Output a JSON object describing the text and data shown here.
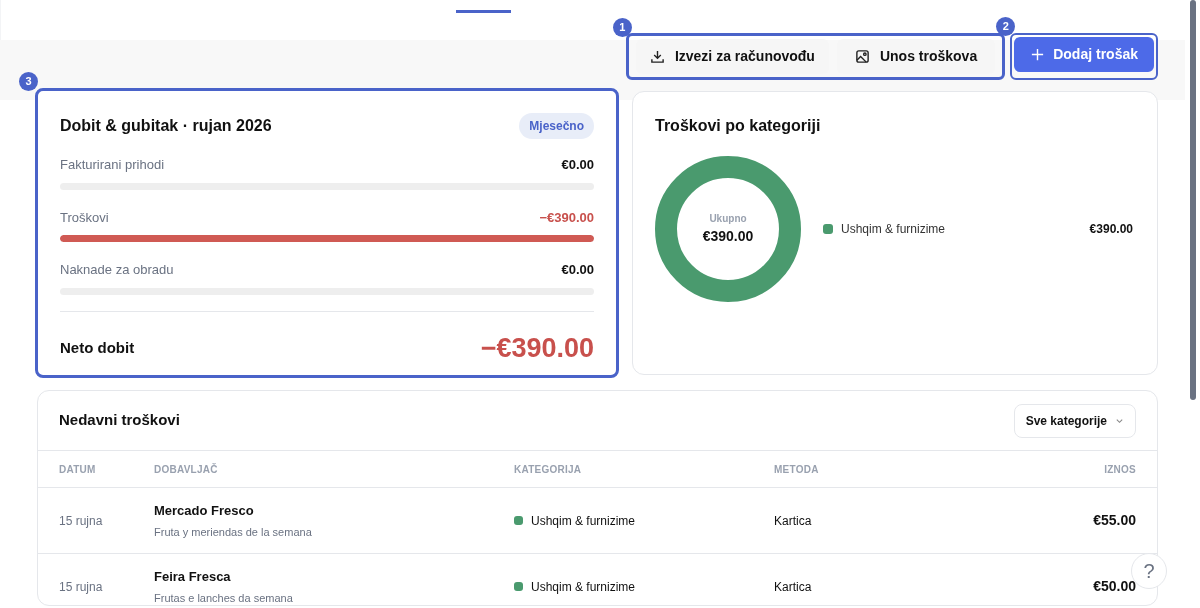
{
  "toolbar": {
    "marker": "1",
    "buttons": [
      {
        "kind": "download",
        "label": "Izvezi za računovođu"
      },
      {
        "kind": "image",
        "label": "Unos troškova"
      }
    ]
  },
  "add_button": {
    "marker": "2",
    "label": "Dodaj trošak"
  },
  "profit_loss": {
    "marker": "3",
    "title": "Dobit & gubitak · rujan 2026",
    "period": "Mjesečno",
    "lines": [
      {
        "label": "Fakturirani prihodi",
        "amount": "€0.00",
        "negative": false,
        "level": 0
      },
      {
        "label": "Troškovi",
        "amount": "−€390.00",
        "negative": true,
        "level": 1
      },
      {
        "label": "Naknade za obradu",
        "amount": "€0.00",
        "negative": false,
        "level": 0
      }
    ],
    "net_label": "Neto dobit",
    "net_amount": "−€390.00",
    "net_negative": true
  },
  "categories": {
    "title": "Troškovi po kategoriji",
    "center_label": "Ukupno",
    "center_value": "€390.00",
    "legend": [
      {
        "label": "Ushqim & furnizime",
        "amount": "€390.00",
        "color": "#4a9a6e"
      }
    ]
  },
  "recent": {
    "title": "Nedavni troškovi",
    "filter": "Sve kategorije",
    "columns": [
      "DATUM",
      "DOBAVLJAČ",
      "KATEGORIJA",
      "METODA",
      "IZNOS"
    ],
    "rows": [
      {
        "date": "15 rujna",
        "vendor": "Mercado Fresco",
        "note": "Fruta y meriendas de la semana",
        "category": "Ushqim & furnizime",
        "color": "#4a9a6e",
        "method": "Kartica",
        "amount": "€55.00"
      },
      {
        "date": "15 rujna",
        "vendor": "Feira Fresca",
        "note": "Frutas e lanches da semana",
        "category": "Ushqim & furnizime",
        "color": "#4a9a6e",
        "method": "Kartica",
        "amount": "€50.00"
      }
    ]
  },
  "help_button": {
    "label": "?"
  }
}
